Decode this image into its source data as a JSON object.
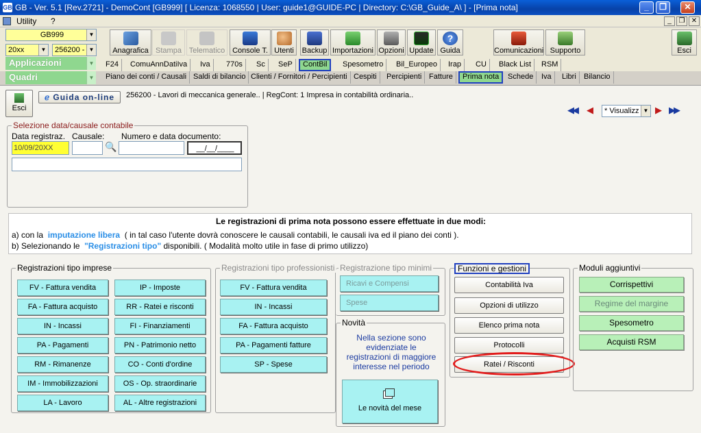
{
  "window": {
    "title": "GB - Ver. 5.1 [Rev.2721] - DemoCont [GB999]   [ Licenza: 1068550 | User: guide1@GUIDE-PC | Directory: C:\\GB_Guide_A\\ ] - [Prima nota]"
  },
  "menubar": {
    "utility": "Utility",
    "help": "?"
  },
  "combos": {
    "company": "GB999",
    "year": "20xx",
    "client": "256200 -"
  },
  "toolbar": {
    "applicazioni": "Applicazioni",
    "quadri": "Quadri",
    "buttons": [
      {
        "label": "Anagrafica"
      },
      {
        "label": "Stampa"
      },
      {
        "label": "Telematico"
      },
      {
        "label": "Console T."
      },
      {
        "label": "Utenti"
      },
      {
        "label": "Backup"
      },
      {
        "label": "Importazioni"
      },
      {
        "label": "Opzioni"
      },
      {
        "label": "Update"
      },
      {
        "label": "Guida"
      },
      {
        "label": "Comunicazioni"
      },
      {
        "label": "Supporto"
      },
      {
        "label": "Esci"
      }
    ]
  },
  "tabs_row1": [
    "F24",
    "ComuAnnDatiIva",
    "Iva",
    "770s",
    "Sc",
    "SeP",
    "ContBil",
    "Spesometro",
    "Bil_Europeo",
    "Irap",
    "CU",
    "Black List",
    "RSM"
  ],
  "tabs_row2": [
    "Piano dei conti / Causali",
    "Saldi di bilancio",
    "Clienti / Fornitori / Percipienti",
    "Cespiti",
    "Percipienti",
    "Fatture",
    "Prima nota",
    "Schede",
    "Iva",
    "Libri",
    "Bilancio"
  ],
  "page": {
    "esci": "Esci",
    "guida": "Guida on-line",
    "company_info": "256200 - Lavori di meccanica generale..  | RegCont: 1 Impresa  in contabilità ordinaria..",
    "view_combo": "* Visualizz"
  },
  "selezione": {
    "legend": "Selezione data/causale contabile",
    "data_label": "Data registraz.",
    "causale_label": "Causale:",
    "numero_label": "Numero e data documento:",
    "data_value": "10/09/20XX",
    "date_mask": "__/__/____"
  },
  "info": {
    "heading": "Le registrazioni di prima nota possono essere effettuate in due modi:",
    "line_a_pre": "a) con la",
    "line_a_link": "imputazione libera",
    "line_a_post": "( in tal caso l'utente dovrà conoscere le causali contabili, le causali iva ed il piano dei conti ).",
    "line_b_pre": "b) Selezionando le",
    "line_b_link": "\"Registrazioni tipo\"",
    "line_b_post": "disponibili. ( Modalità molto utile in fase di primo utilizzo)"
  },
  "imprese": {
    "legend": "Registrazioni tipo imprese",
    "left": [
      "FV - Fattura vendita",
      "FA - Fattura acquisto",
      "IN - Incassi",
      "PA - Pagamenti",
      "RM - Rimanenze",
      "IM - Immobilizzazioni",
      "LA - Lavoro"
    ],
    "right": [
      "IP - Imposte",
      "RR - Ratei e risconti",
      "FI - Finanziamenti",
      "PN - Patrimonio netto",
      "CO - Conti d'ordine",
      "OS - Op. straordinarie",
      "AL - Altre registrazioni"
    ]
  },
  "professionisti": {
    "legend": "Registrazioni tipo professionisti",
    "items": [
      "FV - Fattura vendita",
      "IN - Incassi",
      "FA - Fattura acquisto",
      "PA - Pagamenti fatture",
      "SP - Spese"
    ]
  },
  "minimi": {
    "legend": "Registrazione tipo minimi",
    "items": [
      "Ricavi e Compensi",
      "Spese"
    ]
  },
  "novita": {
    "legend": "Novità",
    "text": "Nella sezione sono evidenziate le registrazioni di maggiore interesse nel periodo",
    "button": "Le novità del mese"
  },
  "funzioni": {
    "legend": "Funzioni e gestioni",
    "items": [
      "Contabilità Iva",
      "Opzioni di utilizzo",
      "Elenco prima nota",
      "Protocolli",
      "Ratei / Risconti"
    ]
  },
  "moduli": {
    "legend": "Moduli aggiuntivi",
    "items": [
      "Corrispettivi",
      "Regime del margine",
      "Spesometro",
      "Acquisti RSM"
    ]
  },
  "colors": {
    "cyan": "#a8f2f2",
    "green": "#b8f0b8",
    "highlight": "#e21b1b",
    "link": "#2a8ee6"
  }
}
